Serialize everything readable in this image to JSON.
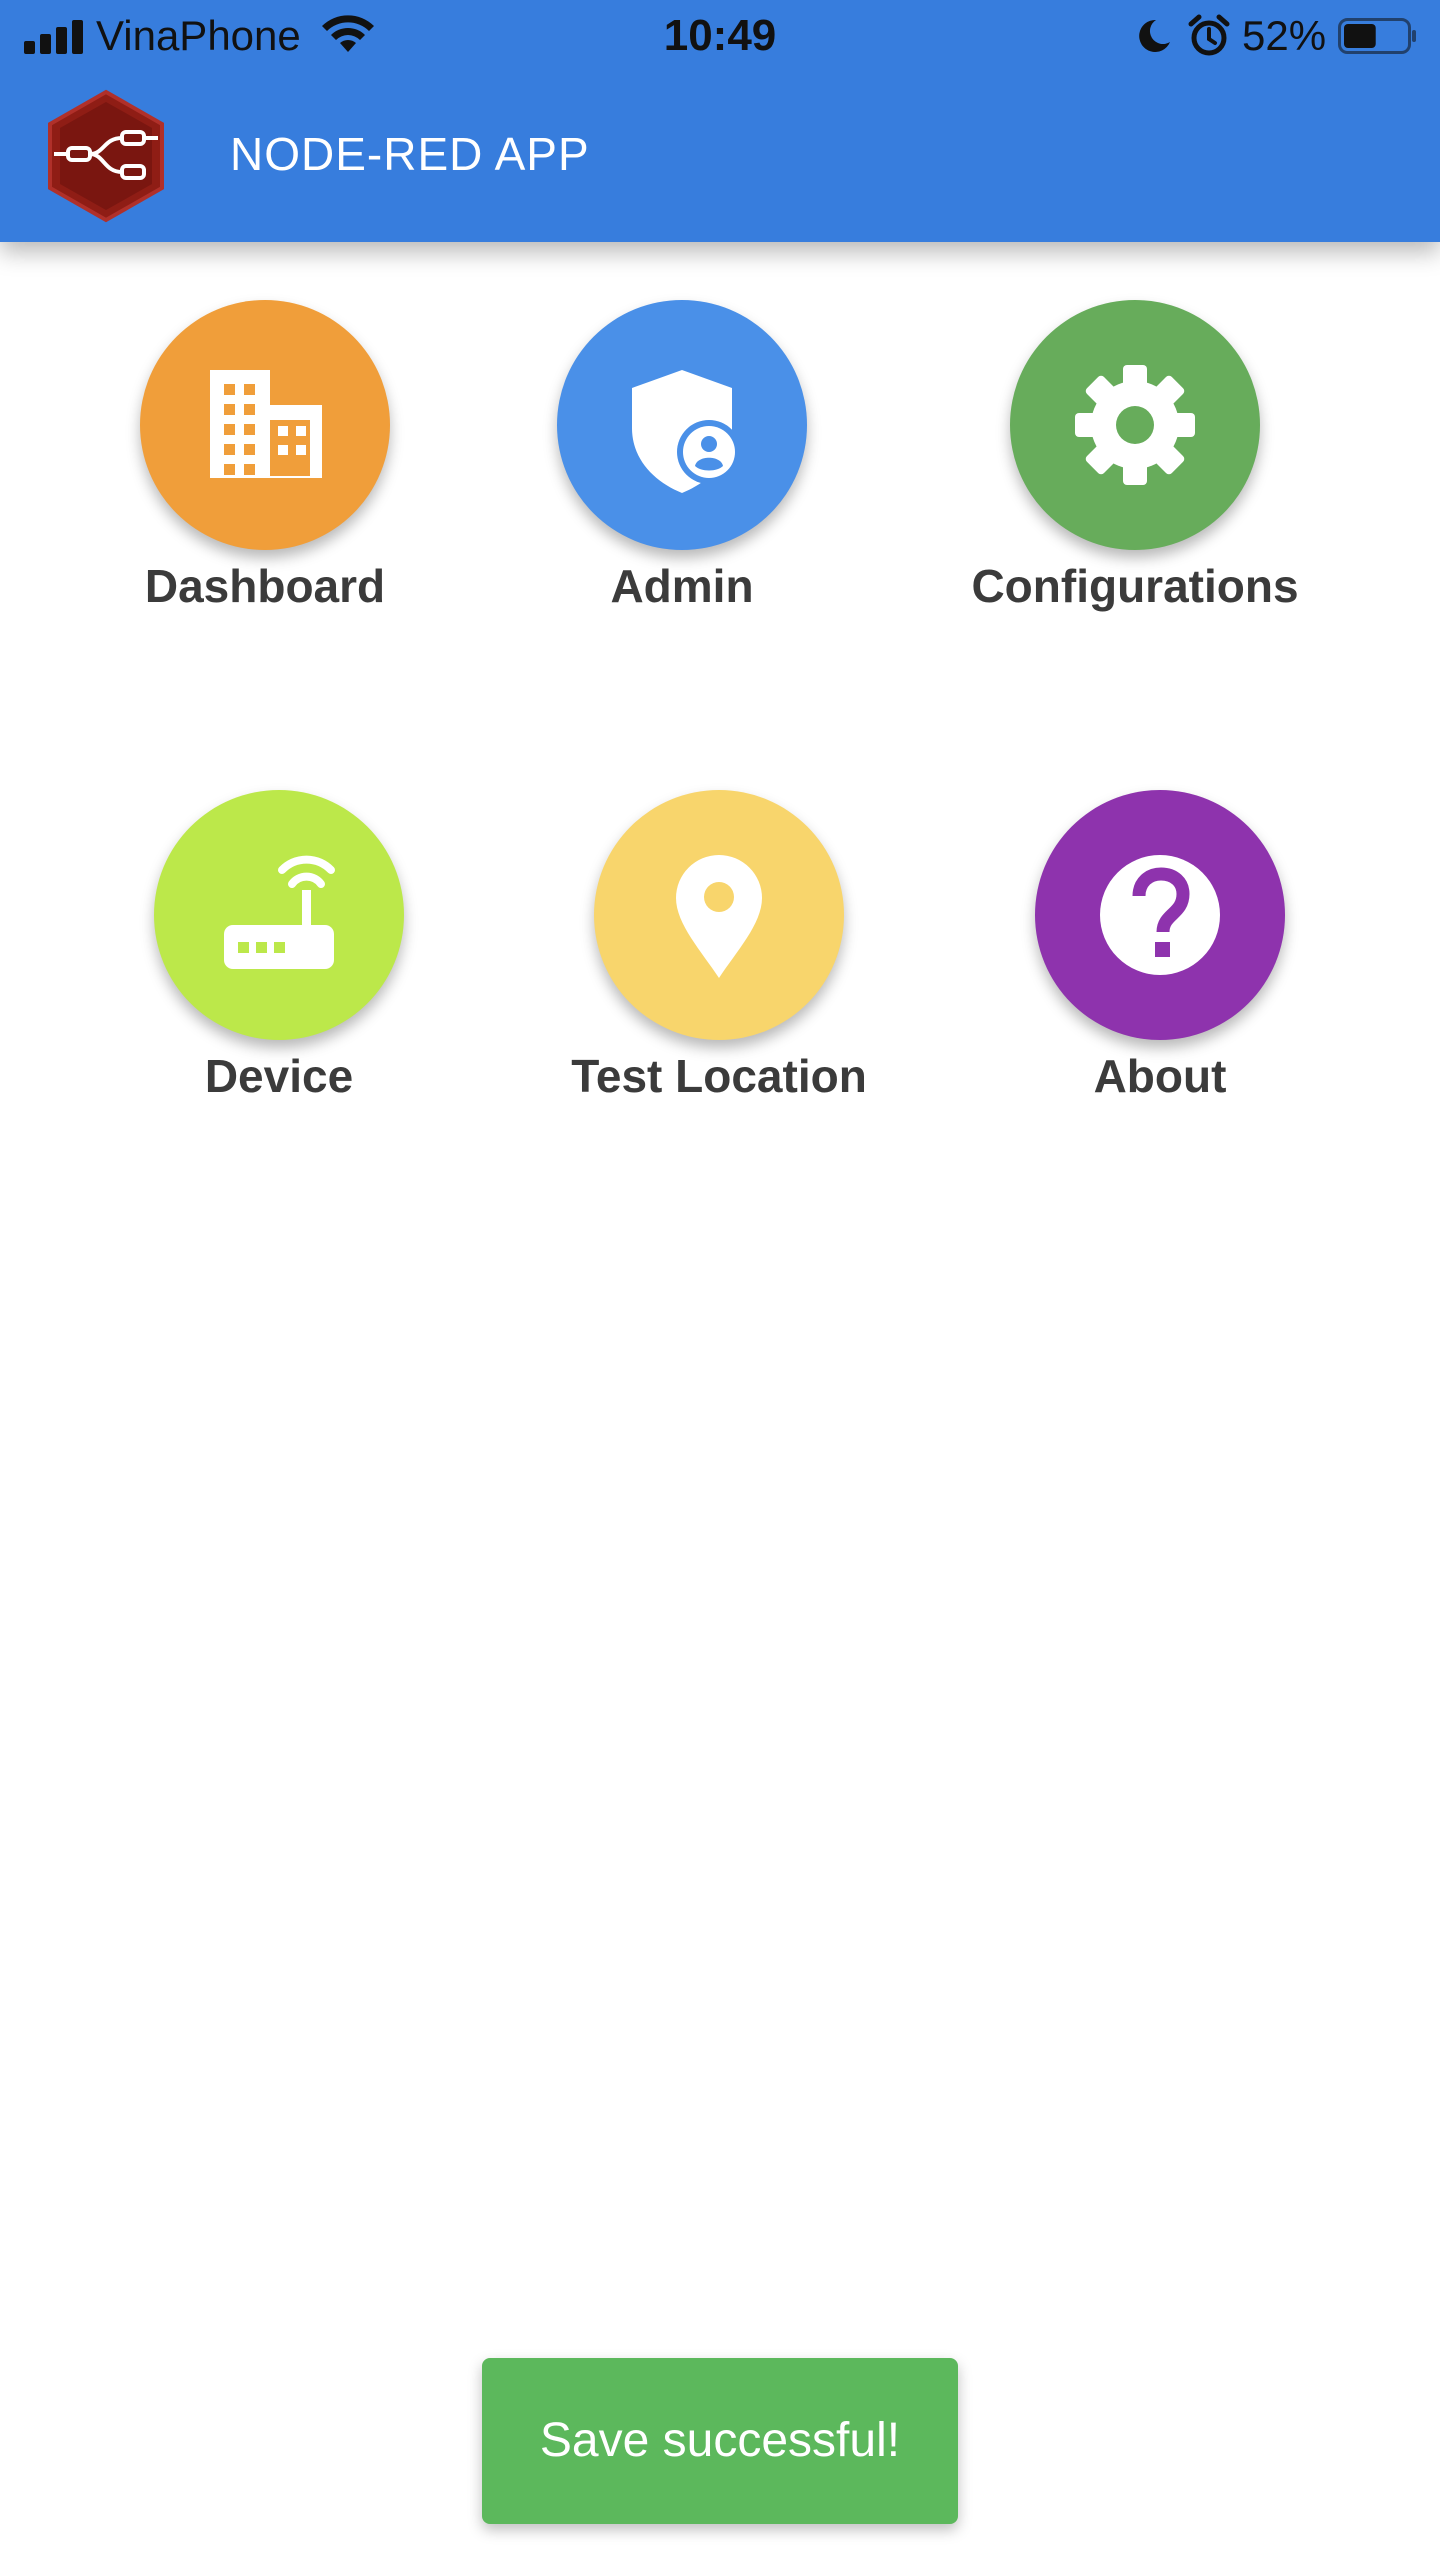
{
  "status_bar": {
    "carrier": "VinaPhone",
    "time": "10:49",
    "battery_percent": "52%",
    "battery_level": 0.52,
    "icons": [
      "signal-icon",
      "wifi-icon",
      "moon-icon",
      "alarm-icon",
      "battery-icon"
    ]
  },
  "app_bar": {
    "title": "NODE-RED APP",
    "logo_icon": "node-red-logo-icon",
    "background_color": "#377ddd"
  },
  "tiles": [
    {
      "label": "Dashboard",
      "icon": "building-icon",
      "color": "#f09e3a"
    },
    {
      "label": "Admin",
      "icon": "shield-user-icon",
      "color": "#4a90e8"
    },
    {
      "label": "Configurations",
      "icon": "gear-icon",
      "color": "#67ac5b"
    },
    {
      "label": "Device",
      "icon": "router-icon",
      "color": "#bce84a"
    },
    {
      "label": "Test Location",
      "icon": "map-pin-icon",
      "color": "#f8d56c"
    },
    {
      "label": "About",
      "icon": "help-icon",
      "color": "#8e33ad"
    }
  ],
  "toast": {
    "message": "Save successful!",
    "color": "#5cb85c"
  }
}
